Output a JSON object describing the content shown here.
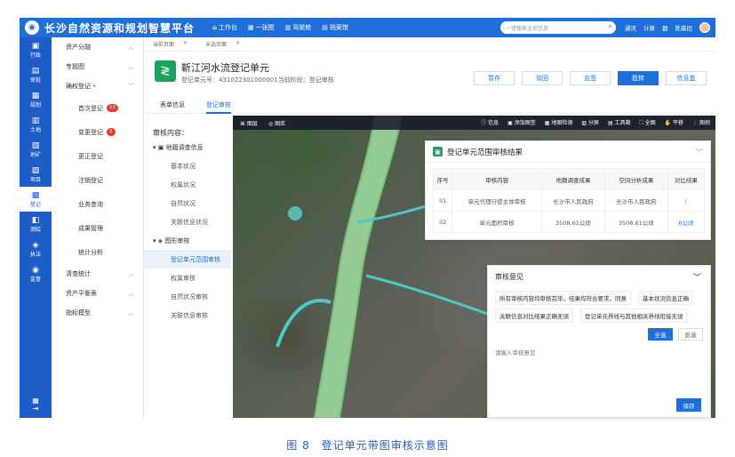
{
  "app": {
    "title": "长沙自然资源和规划智慧平台"
  },
  "topnav": [
    "工作台",
    "一张图",
    "驾驶舱",
    "档案馆"
  ],
  "search": {
    "placeholder": "一键搜索全部信息"
  },
  "toptools": [
    "通讯",
    "计算",
    "器",
    "陈晨旧"
  ],
  "leftnav": [
    "行政",
    "审批",
    "规划",
    "土地",
    "地矿",
    "项目",
    "登记",
    "测绘",
    "执法",
    "监督"
  ],
  "menu": {
    "groups": [
      {
        "label": "资产分融"
      },
      {
        "label": "专题图"
      },
      {
        "label": "确权登记"
      }
    ],
    "subitems": [
      {
        "label": "首次登记",
        "badge": "12"
      },
      {
        "label": "变更登记",
        "badge": "2"
      },
      {
        "label": "更正登记"
      },
      {
        "label": "注销登记"
      },
      {
        "label": "业务查询"
      },
      {
        "label": "成果管理"
      },
      {
        "label": "统计分析"
      }
    ],
    "bottom_groups": [
      {
        "label": "清查统计"
      },
      {
        "label": "资产平衡表"
      },
      {
        "label": "指标模型"
      }
    ]
  },
  "tabs": {
    "current": "当前页面",
    "other": "未选页面"
  },
  "header": {
    "title": "靳江河水流登记单元",
    "subtitle": "登记单元号：431022301000001当前阶段：登记审核",
    "buttons": [
      "暂存",
      "驳回",
      "会签",
      "批转",
      "信息盒"
    ]
  },
  "subtabs": [
    "表单信息",
    "登记审核"
  ],
  "tree": {
    "head": "审核内容：",
    "groups": [
      {
        "label": "地籍调查信息",
        "items": [
          "基本状况",
          "权属状况",
          "自然状况",
          "关联信息状况"
        ]
      },
      {
        "label": "图形审核",
        "items": [
          "登记单元范围审核",
          "权属审核",
          "自然状况审核",
          "关联信息审核"
        ]
      }
    ]
  },
  "maptool": {
    "left": [
      "图层",
      "图库"
    ],
    "right": [
      "信息",
      "添加图签",
      "地图检测",
      "分屏",
      "工具箱",
      "全图",
      "平移",
      "图例"
    ]
  },
  "result": {
    "title": "登记单元范围审核结果",
    "columns": [
      "序号",
      "审核内容",
      "地籍调查成果",
      "空间分析成果",
      "对比结果"
    ],
    "rows": [
      [
        "01",
        "单元代理行使主体审核",
        "长沙市人民政府",
        "长沙市人民政府",
        "/"
      ],
      [
        "02",
        "单元面积审核",
        "3508.61公顷",
        "3508.61公顷",
        "0公顷"
      ]
    ]
  },
  "opinion": {
    "title": "审核意见",
    "chips": [
      "所有审核内容均审核完毕，结果均符合要求，同意",
      "基本状况信息正确",
      "关联信息对比结果正确无误",
      "登记单元界线与其他相关界线衔接无误"
    ],
    "select_all": "全选",
    "invert": "反选",
    "placeholder": "请输入审核意见",
    "save": "保存"
  },
  "caption": "图 8　登记单元带图审核示意图",
  "colors": {
    "primary": "#1e6fd9",
    "nav": "#1e5cc8",
    "green": "#1aa260"
  }
}
